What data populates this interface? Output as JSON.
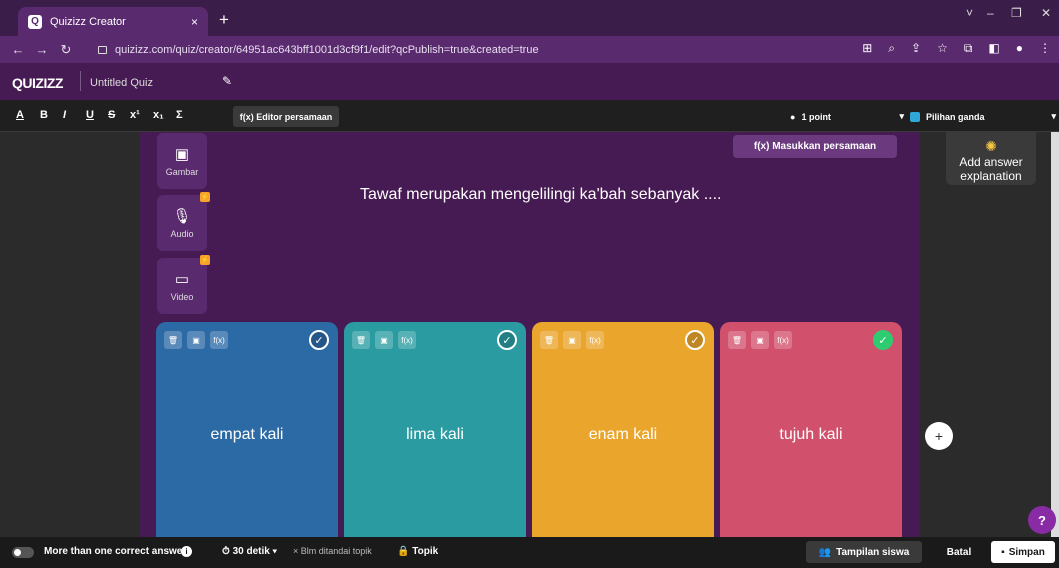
{
  "browser": {
    "tab_title": "Quizizz Creator",
    "tab_close": "×",
    "new_tab": "+",
    "favicon": "Q",
    "url": "quizizz.com/quiz/creator/64951ac643bff1001d3cf9f1/edit?qcPublish=true&created=true",
    "window_controls": [
      "˅",
      "–",
      "❐",
      "✕"
    ]
  },
  "header": {
    "logo": "QUIZIZZ",
    "quiz_name": "Untitled Quiz",
    "edit_icon": "pencil-icon"
  },
  "toolbar": {
    "format_buttons": [
      "A",
      "B",
      "I",
      "U",
      "S",
      "x¹",
      "x₁",
      "Σ"
    ],
    "equation_editor": "f(x) Editor persamaan",
    "points": "1 point",
    "question_type": "Pilihan ganda"
  },
  "media": {
    "image_label": "Gambar",
    "audio_label": "Audio",
    "video_label": "Video"
  },
  "question": {
    "insert_equation": "f(x) Masukkan persamaan",
    "text": "Tawaf merupakan mengelilingi ka'bah sebanyak ...."
  },
  "answers": [
    {
      "text": "empat kali",
      "color": "#2c6aa6",
      "correct": false
    },
    {
      "text": "lima kali",
      "color": "#2a9ca1",
      "correct": false
    },
    {
      "text": "enam kali",
      "color": "#eaa52c",
      "correct": false
    },
    {
      "text": "tujuh kali",
      "color": "#d1506c",
      "correct": true
    }
  ],
  "answer_tools": {
    "delete": "🗑",
    "image": "▣",
    "equation": "f(x)"
  },
  "explanation": {
    "line1": "Add answer",
    "line2": "explanation"
  },
  "bottom": {
    "multi_correct": "More than one correct answer",
    "time": "30 detik",
    "topic_status": "× Blm ditandai topik",
    "topic": "Topik",
    "student_view": "Tampilan siswa",
    "cancel": "Batal",
    "save": "Simpan"
  },
  "colors": {
    "brand": "#461a52",
    "correct_check": "#2ecc71"
  }
}
